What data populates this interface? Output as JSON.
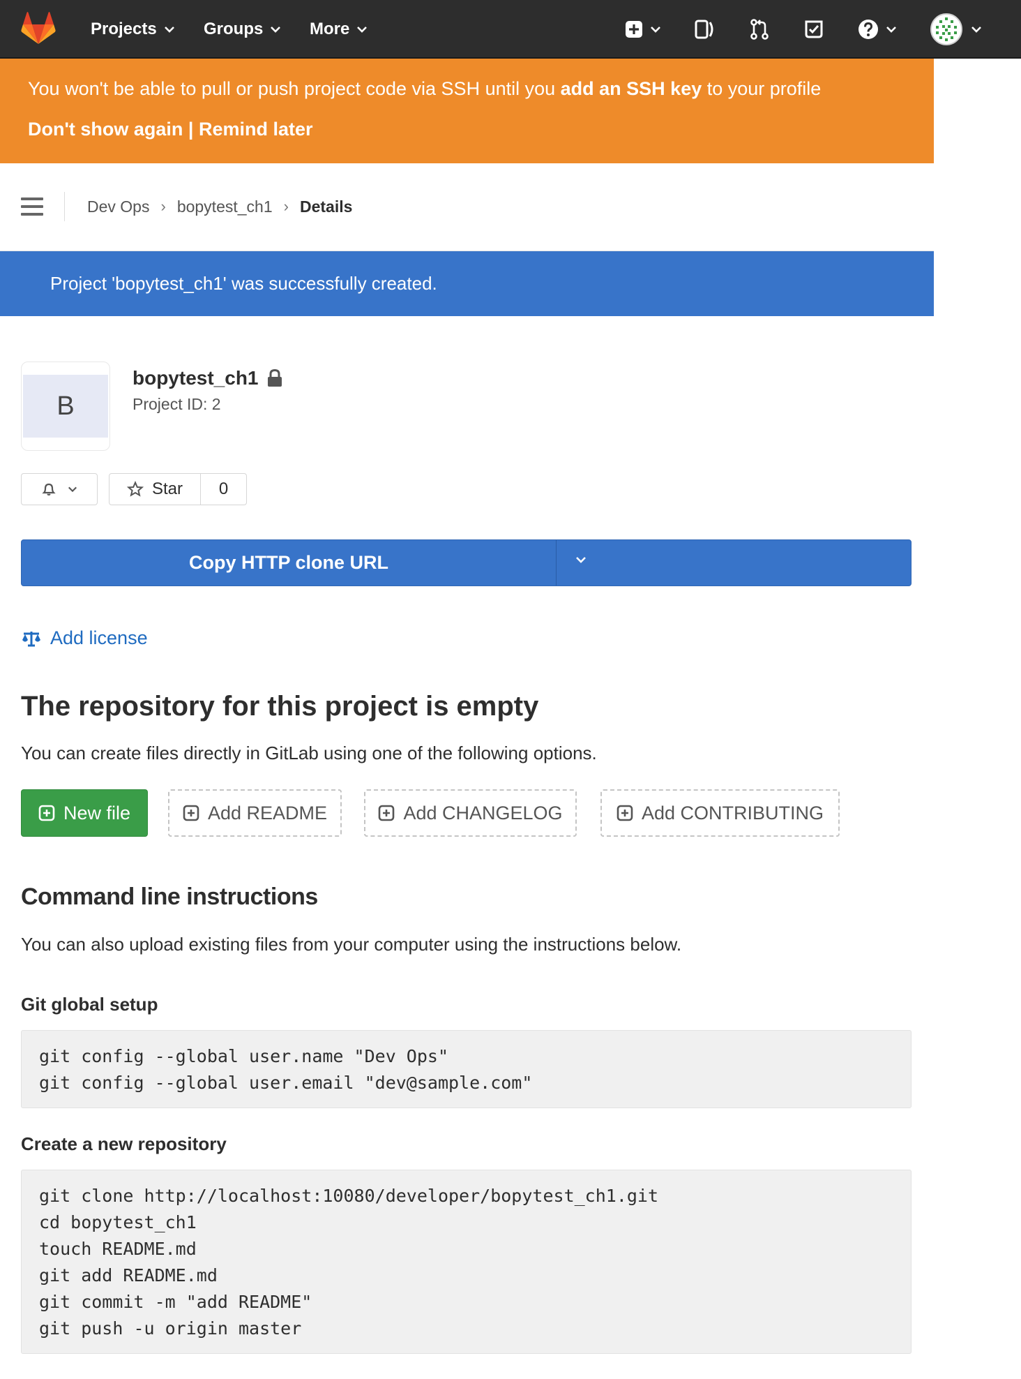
{
  "colors": {
    "navbar": "#2d2d2d",
    "warning": "#ee8b2a",
    "info": "#3874c9",
    "success": "#3a9d48",
    "link": "#1f6bc0"
  },
  "navbar": {
    "projects_label": "Projects",
    "groups_label": "Groups",
    "more_label": "More",
    "icons": [
      "gitlab-logo-icon",
      "plus-square-icon",
      "issues-icon",
      "merge-request-icon",
      "todo-check-icon",
      "help-icon",
      "user-avatar"
    ]
  },
  "ssh_banner": {
    "text_before": "You won't be able to pull or push project code via SSH until you ",
    "link_text": "add an SSH key",
    "text_after": " to your profile",
    "dont_show": "Don't show again",
    "separator": " | ",
    "remind_later": "Remind later"
  },
  "breadcrumb": {
    "items": [
      "Dev Ops",
      "bopytest_ch1",
      "Details"
    ],
    "separator": "›"
  },
  "flash": {
    "message": "Project 'bopytest_ch1' was successfully created."
  },
  "project": {
    "avatar_letter": "B",
    "name": "bopytest_ch1",
    "id_label": "Project ID: 2",
    "star_label": "Star",
    "star_count": "0"
  },
  "clone": {
    "button_label": "Copy HTTP clone URL"
  },
  "license": {
    "label": "Add license"
  },
  "empty_repo": {
    "title": "The repository for this project is empty",
    "subtitle": "You can create files directly in GitLab using one of the following options.",
    "buttons": {
      "new_file": "New file",
      "add_readme": "Add README",
      "add_changelog": "Add CHANGELOG",
      "add_contributing": "Add CONTRIBUTING"
    }
  },
  "command_line": {
    "title": "Command line instructions",
    "description": "You can also upload existing files from your computer using the instructions below.",
    "global_setup": {
      "title": "Git global setup",
      "lines": [
        "git config --global user.name \"Dev Ops\"",
        "git config --global user.email \"dev@sample.com\""
      ]
    },
    "new_repo": {
      "title": "Create a new repository",
      "lines": [
        "git clone http://localhost:10080/developer/bopytest_ch1.git",
        "cd bopytest_ch1",
        "touch README.md",
        "git add README.md",
        "git commit -m \"add README\"",
        "git push -u origin master"
      ]
    }
  }
}
